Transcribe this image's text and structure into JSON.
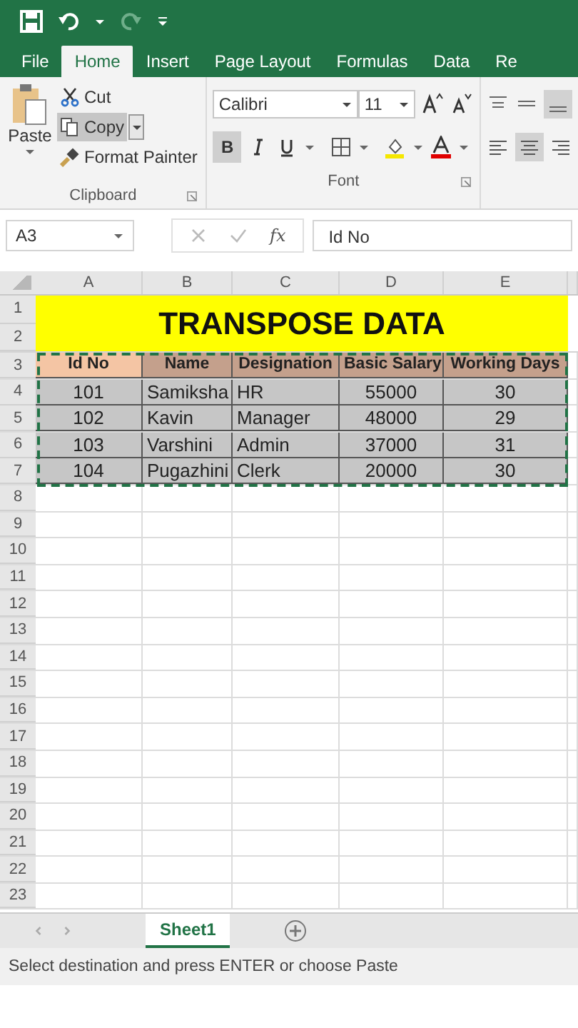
{
  "ribbon_tabs": [
    {
      "label": "File",
      "selected": false
    },
    {
      "label": "Home",
      "selected": true
    },
    {
      "label": "Insert",
      "selected": false
    },
    {
      "label": "Page Layout",
      "selected": false
    },
    {
      "label": "Formulas",
      "selected": false
    },
    {
      "label": "Data",
      "selected": false
    },
    {
      "label": "Re",
      "selected": false
    }
  ],
  "clipboard": {
    "paste": "Paste",
    "cut": "Cut",
    "copy": "Copy",
    "copy_active": true,
    "format_painter": "Format Painter",
    "title": "Clipboard"
  },
  "font": {
    "name": "Calibri",
    "size": "11",
    "bold_label": "B",
    "bold_active": true,
    "title": "Font"
  },
  "function_symbol": "fx",
  "name_box": "A3",
  "formula": "Id No",
  "columns": [
    "A",
    "B",
    "C",
    "D",
    "E"
  ],
  "row_numbers": [
    "1",
    "2",
    "3",
    "4",
    "5",
    "6",
    "7",
    "8",
    "9",
    "10",
    "11",
    "12",
    "13",
    "14",
    "15",
    "16",
    "17",
    "18",
    "19",
    "20",
    "21",
    "22",
    "23"
  ],
  "sheet_title": "TRANSPOSE DATA",
  "header_cells": [
    {
      "text": "Id No",
      "active": true
    },
    {
      "text": "Name",
      "active": false
    },
    {
      "text": "Designation",
      "active": false
    },
    {
      "text": "Basic Salary",
      "active": false
    },
    {
      "text": "Working Days",
      "active": false
    }
  ],
  "data_rows": [
    [
      "101",
      "Samiksha",
      "HR",
      "55000",
      "30"
    ],
    [
      "102",
      "Kavin",
      "Manager",
      "48000",
      "29"
    ],
    [
      "103",
      "Varshini",
      "Admin",
      "37000",
      "31"
    ],
    [
      "104",
      "Pugazhini",
      "Clerk",
      "20000",
      "30"
    ]
  ],
  "copy_marquee": true,
  "sheet_tabs": [
    {
      "label": "Sheet1",
      "selected": true
    }
  ],
  "status": "Select destination and press ENTER or choose Paste"
}
